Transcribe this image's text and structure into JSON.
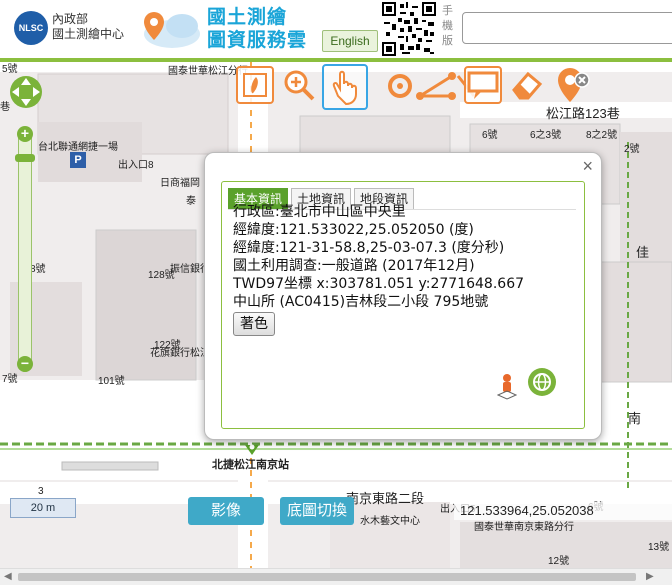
{
  "header": {
    "logo_text": "NLSC",
    "department_lines": [
      "內政部",
      "國土測繪中心"
    ],
    "title_lines": [
      "國土測繪",
      "圖資服務雲"
    ],
    "language_button": "English",
    "mobile_label": "手機版",
    "search": {
      "value": "",
      "placeholder": ""
    }
  },
  "toolbar": {
    "tools": [
      {
        "name": "taiwan-map-icon",
        "selected": false
      },
      {
        "name": "zoom-in-icon",
        "selected": false
      },
      {
        "name": "pan-hand-icon",
        "selected": true
      },
      {
        "name": "point-locate-icon",
        "selected": false
      },
      {
        "name": "measure-distance-icon",
        "selected": false
      },
      {
        "name": "measure-area-icon",
        "selected": false
      },
      {
        "name": "speech-bubble-icon",
        "selected": false
      },
      {
        "name": "eraser-icon",
        "selected": false
      },
      {
        "name": "marker-clear-icon",
        "selected": false
      }
    ]
  },
  "map_labels": {
    "cathay_branch_top": "國泰世華松江分行",
    "taipei_parking": "台北聯通網捷一場",
    "parking_symbol": "P",
    "exit8": "出入口8",
    "nichi_fuku": "日商福岡",
    "tai": "泰",
    "no5": "5號",
    "no8": "8號",
    "no128": "128號",
    "no122": "122號",
    "no101": "101號",
    "zhengxin": "振信銀行",
    "huaqi": "花旗銀行松江",
    "no7": "7號",
    "songjiang_lane": "松江路123巷",
    "num_6": "6號",
    "num_6_3": "6之3號",
    "num_8_2": "8之2號",
    "num_2": "2號",
    "station": "北捷松江南京站",
    "nanjing_east_road": "南京東路二段",
    "exit5": "出入口5",
    "shuimu": "水木藝文中心",
    "cathay_nanjing": "國泰世華南京東路分行",
    "no6_right": "6號",
    "no13": "13號",
    "no12": "12號",
    "nan": "南",
    "jia": "佳",
    "xiang": "巷",
    "small_label": "3"
  },
  "popup": {
    "close_label": "×",
    "tabs": [
      {
        "label": "基本資訊",
        "active": true
      },
      {
        "label": "土地資訊",
        "active": false
      },
      {
        "label": "地段資訊",
        "active": false
      }
    ],
    "info_lines": [
      "行政區:臺北市中山區中央里",
      "經緯度:121.533022,25.052050 (度)",
      "經緯度:121-31-58.8,25-03-07.3 (度分秒)",
      "國土利用調查:一般道路 (2017年12月)",
      "TWD97坐標 x:303781.051 y:2771648.667",
      "中山所 (AC0415)吉林段二小段 795地號"
    ],
    "color_button": "著色"
  },
  "zoom": {
    "plus": "+",
    "minus": "−",
    "level": 0.15
  },
  "bottom": {
    "scale_label": "20 m",
    "imagery_button": "影像",
    "basemap_button": "底圖切換",
    "coordinate_readout": "121.533964,25.052038"
  },
  "colors": {
    "accent_green": "#8cbf3f",
    "tool_orange": "#f08a3c",
    "selected_blue": "#39a6e5",
    "button_teal": "#3fa9c8",
    "tab_green": "#5aa12b"
  }
}
